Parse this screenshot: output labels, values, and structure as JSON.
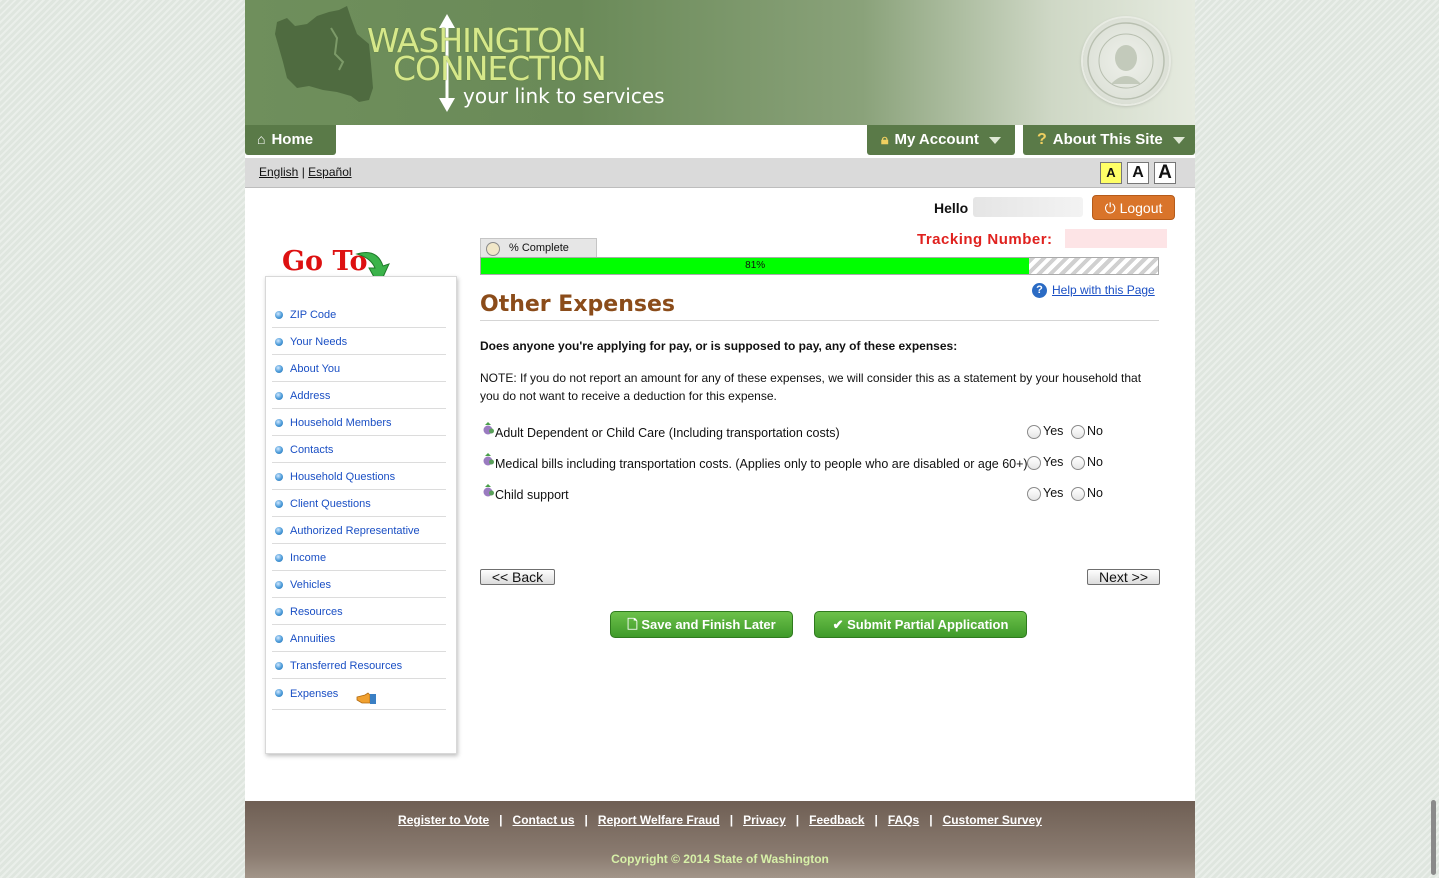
{
  "header": {
    "brand_line1": "WASHINGTON",
    "brand_line2": "CONNECTION",
    "tagline": "your link to services"
  },
  "nav": {
    "home": "Home",
    "my_account": "My Account",
    "about": "About This Site"
  },
  "language": {
    "english": "English",
    "separator": "|",
    "spanish": "Español"
  },
  "font_size": {
    "small": "A",
    "medium": "A",
    "large": "A"
  },
  "user": {
    "hello": "Hello",
    "logout": "Logout",
    "tracking_label": "Tracking Number:"
  },
  "goto": {
    "title": "Go To",
    "items": [
      "ZIP Code",
      "Your Needs",
      "About You",
      "Address",
      "Household Members",
      "Contacts",
      "Household Questions",
      "Client Questions",
      "Authorized Representative",
      "Income",
      "Vehicles",
      "Resources",
      "Annuities",
      "Transferred Resources",
      "Expenses"
    ],
    "current": "Expenses"
  },
  "progress": {
    "tab_label": "% Complete",
    "percent_label": "81%",
    "fraction": 0.81
  },
  "help": {
    "label": "Help with this Page"
  },
  "main": {
    "title": "Other Expenses",
    "question": "Does anyone you're applying for pay, or is supposed to pay, any of these expenses:",
    "note": "NOTE: If you do not report an amount for any of these expenses, we will consider this as a statement by your household that you do not want to receive a deduction for this expense.",
    "expenses": [
      {
        "label": "Adult Dependent or Child Care (Including transportation costs)",
        "yes": "Yes",
        "no": "No"
      },
      {
        "label": "Medical bills including transportation costs. (Applies only to people who are disabled or age 60+)",
        "yes": "Yes",
        "no": "No"
      },
      {
        "label": "Child support",
        "yes": "Yes",
        "no": "No"
      }
    ],
    "back": "<< Back",
    "next": "Next >>",
    "save": "Save and Finish Later",
    "submit": "Submit Partial Application"
  },
  "footer": {
    "links": [
      "Register to Vote",
      "Contact us",
      "Report Welfare Fraud",
      "Privacy",
      "Feedback",
      "FAQs",
      "Customer Survey"
    ],
    "separator": "|",
    "copyright": "Copyright © 2014 State of Washington"
  },
  "colors": {
    "banner_green": "#6a8a58",
    "nav_green": "#5a7a48",
    "progress_green": "#00ff00",
    "title_brown": "#8b4c1a",
    "tracking_red": "#e0221f",
    "logout_orange": "#d9742a",
    "link_blue": "#1a4fc4"
  }
}
